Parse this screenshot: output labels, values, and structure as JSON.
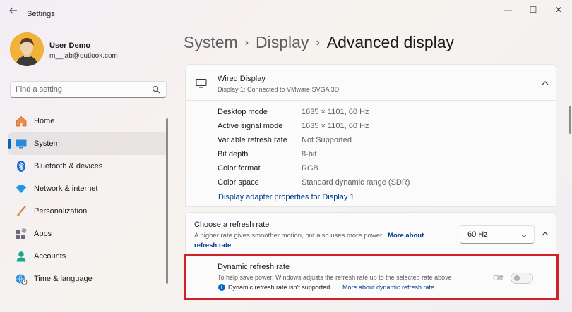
{
  "window": {
    "title": "Settings",
    "controls": {
      "minimize": "—",
      "maximize": "☐",
      "close": "✕"
    }
  },
  "user": {
    "name": "User Demo",
    "email": "m__lab@outlook.com"
  },
  "search": {
    "placeholder": "Find a setting"
  },
  "nav": {
    "items": [
      {
        "label": "Home",
        "icon": "home-icon"
      },
      {
        "label": "System",
        "icon": "system-icon",
        "active": true
      },
      {
        "label": "Bluetooth & devices",
        "icon": "bluetooth-icon"
      },
      {
        "label": "Network & internet",
        "icon": "wifi-icon"
      },
      {
        "label": "Personalization",
        "icon": "brush-icon"
      },
      {
        "label": "Apps",
        "icon": "apps-icon"
      },
      {
        "label": "Accounts",
        "icon": "accounts-icon"
      },
      {
        "label": "Time & language",
        "icon": "globe-clock-icon"
      }
    ]
  },
  "breadcrumb": {
    "part1": "System",
    "part2": "Display",
    "current": "Advanced display",
    "sep": "›"
  },
  "wired": {
    "title": "Wired Display",
    "subtitle": "Display 1: Connected to VMware SVGA 3D",
    "properties": [
      {
        "label": "Desktop mode",
        "value": "1635 × 1101, 60 Hz"
      },
      {
        "label": "Active signal mode",
        "value": "1635 × 1101, 60 Hz"
      },
      {
        "label": "Variable refresh rate",
        "value": "Not Supported"
      },
      {
        "label": "Bit depth",
        "value": "8-bit"
      },
      {
        "label": "Color format",
        "value": "RGB"
      },
      {
        "label": "Color space",
        "value": "Standard dynamic range (SDR)"
      }
    ],
    "adapter_link": "Display adapter properties for Display 1"
  },
  "refresh": {
    "title": "Choose a refresh rate",
    "desc": "A higher rate gives smoother motion, but also uses more power",
    "link": "More about refresh rate",
    "selected": "60 Hz"
  },
  "dynamic": {
    "title": "Dynamic refresh rate",
    "desc": "To help save power, Windows adjusts the refresh rate up to the selected rate above",
    "note": "Dynamic refresh rate isn't supported",
    "link": "More about dynamic refresh rate",
    "toggle_label": "Off",
    "info_glyph": "i"
  },
  "colors": {
    "accent": "#0067c0",
    "link": "#003e92",
    "highlight": "#d0202a",
    "avatar": "#f1b23a"
  }
}
